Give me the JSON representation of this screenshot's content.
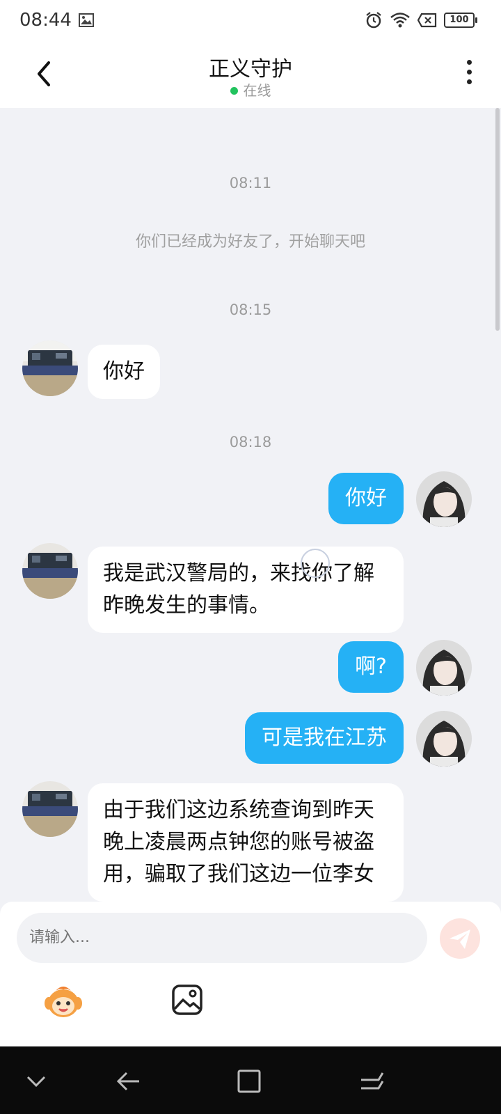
{
  "status_bar": {
    "time": "08:44",
    "battery": "100"
  },
  "header": {
    "title": "正义守护",
    "status": "在线"
  },
  "chat": {
    "time_1": "08:11",
    "system_message": "你们已经成为好友了，开始聊天吧",
    "time_2": "08:15",
    "msg_1": "你好",
    "time_3": "08:18",
    "msg_2": "你好",
    "msg_3_line1": "我是武汉警局的，来找你了解",
    "msg_3_line2": "昨晚发生的事情。",
    "msg_4": "啊?",
    "msg_5": "可是我在江苏",
    "msg_6_line1": "由于我们这边系统查询到昨天",
    "msg_6_line2": "晚上凌晨两点钟您的账号被盗",
    "msg_6_line3": "用，骗取了我们这边一位李女"
  },
  "input": {
    "placeholder": "请输入..."
  },
  "colors": {
    "sent_bubble": "#25b1f5",
    "received_bubble": "#ffffff",
    "chat_bg": "#f1f2f6",
    "online_dot": "#22c35e"
  },
  "icons": [
    "back-arrow-icon",
    "more-vertical-icon",
    "send-icon",
    "emoji-icon",
    "image-icon",
    "alarm-icon",
    "wifi-icon",
    "battery-icon"
  ]
}
